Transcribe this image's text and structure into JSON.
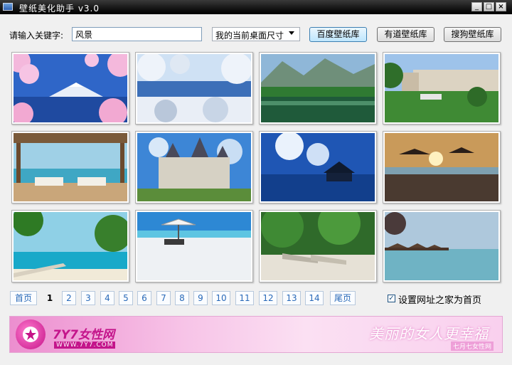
{
  "window": {
    "title": "壁纸美化助手 v3.0",
    "app_icon": "monitor-icon",
    "controls": {
      "minimize": "_",
      "maximize": "□",
      "close": "×"
    }
  },
  "search": {
    "label": "请输入关键字:",
    "value": "风景",
    "size_select": "我的当前桌面尺寸"
  },
  "buttons": {
    "baidu": "百度壁纸库",
    "youdao": "有道壁纸库",
    "sogou": "搜狗壁纸库"
  },
  "wallpapers": [
    {
      "subject": "mount-fuji-cherry-blossom"
    },
    {
      "subject": "snowy-lake-trees"
    },
    {
      "subject": "green-lake-mountains"
    },
    {
      "subject": "palace-garden"
    },
    {
      "subject": "beach-gazebo"
    },
    {
      "subject": "castle"
    },
    {
      "subject": "ocean-hut-blue-sky"
    },
    {
      "subject": "beach-sunset-umbrellas"
    },
    {
      "subject": "tropical-beach-pier"
    },
    {
      "subject": "white-beach-umbrella"
    },
    {
      "subject": "lounge-chairs-trees"
    },
    {
      "subject": "water-bungalows"
    }
  ],
  "pager": {
    "first": "首页",
    "pages": [
      "1",
      "2",
      "3",
      "4",
      "5",
      "6",
      "7",
      "8",
      "9",
      "10",
      "11",
      "12",
      "13",
      "14"
    ],
    "current": "1",
    "last": "尾页"
  },
  "homepage_option": {
    "label": "设置网址之家为首页",
    "checked": true
  },
  "banner": {
    "logo": "7Y7女性网",
    "url": "WWW.7Y7.COM",
    "slogan": "美丽的女人更幸福",
    "slogan_sub": "七月七女性网"
  },
  "colors": {
    "titlebar": "#000000",
    "link_blue": "#2a6ab8",
    "brand_pink": "#c4158b"
  }
}
